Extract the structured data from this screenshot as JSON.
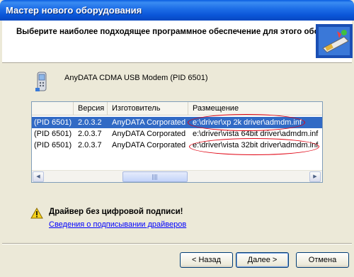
{
  "window": {
    "title": "Мастер нового оборудования"
  },
  "header": {
    "text": "Выберите наиболее подходящее программное обеспечение для этого оборудо"
  },
  "device": {
    "name": "AnyDATA CDMA USB Modem (PID 6501)"
  },
  "list": {
    "columns": [
      "Версия",
      "Изготовитель",
      "Размещение"
    ],
    "rows": [
      {
        "name": "(PID 6501)",
        "version": "2.0.3.2",
        "maker": "AnyDATA Corporated",
        "location": "e:\\driver\\xp 2k driver\\admdm.inf"
      },
      {
        "name": "(PID 6501)",
        "version": "2.0.3.7",
        "maker": "AnyDATA Corporated",
        "location": "e:\\driver\\vista 64bit driver\\admdm.inf"
      },
      {
        "name": "(PID 6501)",
        "version": "2.0.3.7",
        "maker": "AnyDATA Corporated",
        "location": "e:\\driver\\vista 32bit driver\\admdm.inf"
      }
    ],
    "selected_row": 0
  },
  "warning": {
    "text": "Драйвер без цифровой подписи!",
    "link": "Сведения о подписывании драйверов"
  },
  "buttons": {
    "back": "< Назад",
    "next": "Далее >",
    "cancel": "Отмена"
  },
  "colors": {
    "titlebar": "#0a55d8",
    "selection": "#316ac5",
    "annotation_oval": "#e00010",
    "link": "#0000ff"
  }
}
